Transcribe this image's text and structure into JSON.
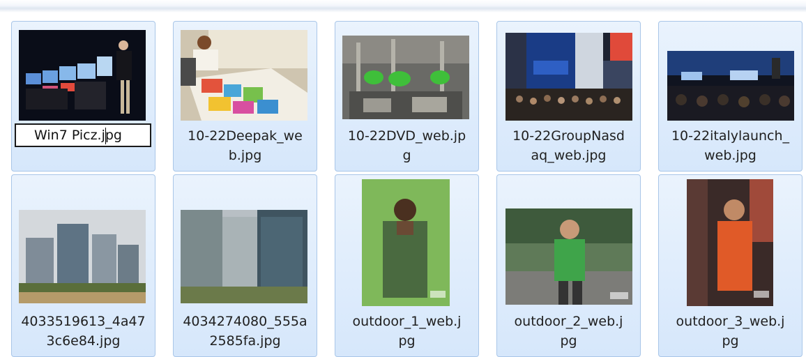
{
  "files": [
    {
      "name_line1": "Win7 Picz.jpg",
      "name_line2": "",
      "renaming": true,
      "thumb": "photo-people-laptops"
    },
    {
      "name_line1": "10-22Deepak_we",
      "name_line2": "b.jpg",
      "thumb": "photo-painting"
    },
    {
      "name_line1": "10-22DVD_web.jp",
      "name_line2": "g",
      "thumb": "photo-machine"
    },
    {
      "name_line1": "10-22GroupNasd",
      "name_line2": "aq_web.jpg",
      "thumb": "photo-nasdaq"
    },
    {
      "name_line1": "10-22italylaunch_",
      "name_line2": "web.jpg",
      "thumb": "photo-launch"
    },
    {
      "name_line1": "4033519613_4a47",
      "name_line2": "3c6e84.jpg",
      "thumb": "photo-buildings"
    },
    {
      "name_line1": "4034274080_555a",
      "name_line2": "2585fa.jpg",
      "thumb": "photo-towers"
    },
    {
      "name_line1": "outdoor_1_web.j",
      "name_line2": "pg",
      "thumb": "poster-outdoor-1"
    },
    {
      "name_line1": "outdoor_2_web.j",
      "name_line2": "pg",
      "thumb": "poster-outdoor-2"
    },
    {
      "name_line1": "outdoor_3_web.j",
      "name_line2": "pg",
      "thumb": "poster-outdoor-3"
    }
  ],
  "rename_value": "Win7 Picz.jpg"
}
